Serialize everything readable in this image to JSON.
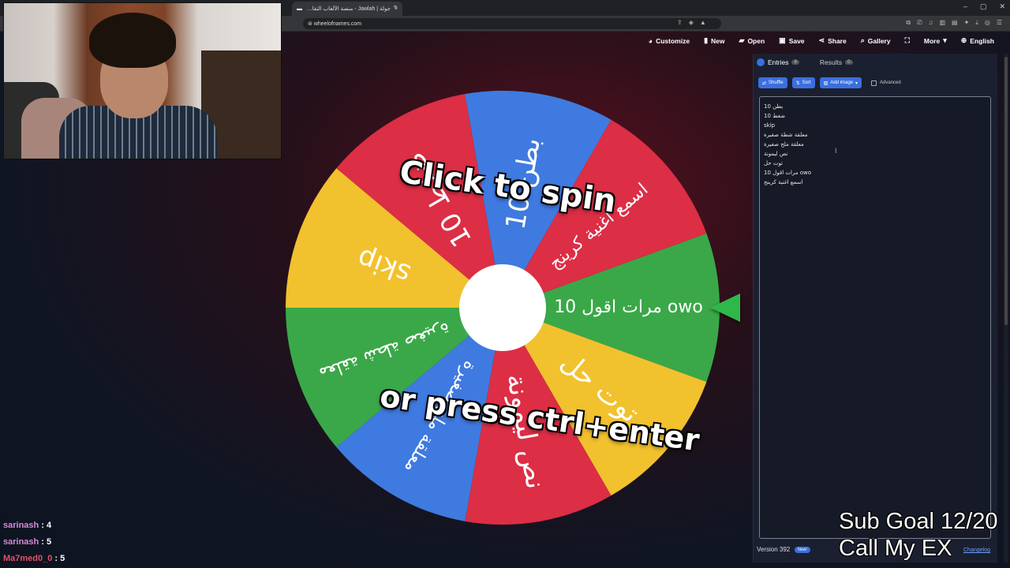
{
  "browser": {
    "tab_title": "جولة | Jawlah - منصة الألعاب التفاعلية",
    "url": "wheelofnames.com"
  },
  "topnav": {
    "customize": "Customize",
    "new": "New",
    "open": "Open",
    "save": "Save",
    "share": "Share",
    "gallery": "Gallery",
    "more": "More",
    "language": "English"
  },
  "wheel": {
    "cta_line1": "Click to spin",
    "cta_line2": "or press ctrl+enter",
    "segments": [
      {
        "label": "مرات اقول 10 owo",
        "color": "#3aa848"
      },
      {
        "label": "توت حل",
        "color": "#f2c12e"
      },
      {
        "label": "نص ليمونة",
        "color": "#dc2e45"
      },
      {
        "label": "معلقة ملح صغيرة",
        "color": "#3f7ae0"
      },
      {
        "label": "معلقة شطة صغيرة",
        "color": "#3aa848"
      },
      {
        "label": "skip",
        "color": "#f2c12e"
      },
      {
        "label": "ضغط 10",
        "color": "#dc2e45"
      },
      {
        "label": "بطن 10",
        "color": "#3f7ae0"
      },
      {
        "label": "اسمع اغنية كرينج",
        "color": "#dc2e45"
      }
    ]
  },
  "panel": {
    "tab_entries": "Entries",
    "entries_count": "9",
    "tab_results": "Results",
    "results_count": "0",
    "shuffle": "Shuffle",
    "sort": "Sort",
    "add_image": "Add image",
    "advanced": "Advanced",
    "entries": [
      "بطن 10",
      "ضغط 10",
      "skip",
      "معلقة شطة صغيرة",
      "معلقة ملح صغيرة",
      "نص ليمونة",
      "توت حل",
      "مرات اقول 10 owo",
      "اسمع اغنية كرينج"
    ],
    "version": "Version 392",
    "new_badge": "New!",
    "changelog": "Changelog"
  },
  "chat": [
    {
      "user": "sarinash",
      "text": " : 4"
    },
    {
      "user": "sarinash",
      "text": " : 5"
    },
    {
      "user": "Ma7med0_0",
      "text": " : 5"
    }
  ],
  "overlay": {
    "line1": "Sub Goal 12/20",
    "line2": "Call My EX"
  },
  "colors": {
    "accent": "#3b6fe0",
    "green": "#3aa848",
    "yellow": "#f2c12e",
    "red": "#dc2e45",
    "blue": "#3f7ae0"
  }
}
